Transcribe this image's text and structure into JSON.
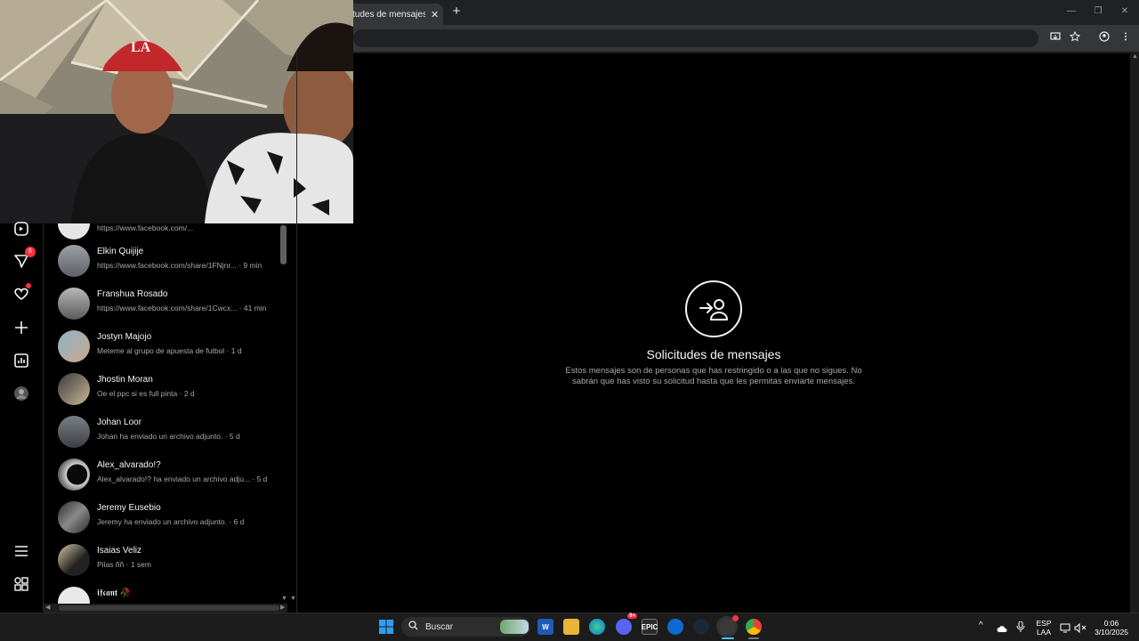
{
  "browser": {
    "tab_title": "tudes de mensajes • D",
    "tab_close": "✕",
    "new_tab": "+",
    "win_min": "—",
    "win_max": "❐",
    "win_close": "✕"
  },
  "nav": {
    "messages_badge": "6"
  },
  "requests": [
    {
      "name": "",
      "preview": "https://www.facebook.com/...",
      "time": ""
    },
    {
      "name": "Elkin Quijije",
      "preview": "https://www.facebook.com/share/1FNjnr...",
      "time": "9 min"
    },
    {
      "name": "Franshua Rosado",
      "preview": "https://www.facebook.com/share/1Cwcx...",
      "time": "41 min"
    },
    {
      "name": "Jostyn Majojo",
      "preview": "Meteme al grupo de apuesta de futbol",
      "time": "1 d"
    },
    {
      "name": "Jhostin Moran",
      "preview": "Oe el ppc si es full pinta",
      "time": "2 d"
    },
    {
      "name": "Johan Loor",
      "preview": "Johan ha enviado un archivo adjunto.",
      "time": "5 d"
    },
    {
      "name": "Alex_alvarado!?",
      "preview": "Alex_alvarado!? ha enviado un archivo adju...",
      "time": "5 d"
    },
    {
      "name": "Jeremy Eusebio",
      "preview": "Jeremy ha enviado un archivo adjunto.",
      "time": "6 d"
    },
    {
      "name": "Isaias Veliz",
      "preview": "Pilas ññ",
      "time": "1 sem"
    },
    {
      "name": "𝖎𝖋𝖈𝖆𝖓𝖙 🥀",
      "preview": "",
      "time": ""
    }
  ],
  "main": {
    "title": "Solicitudes de mensajes",
    "description": "Estos mensajes son de personas que has restringido o a las que no sigues. No sabrán que has visto su solicitud hasta que les permitas enviarte mensajes."
  },
  "taskbar": {
    "search_label": "Buscar",
    "lang_1": "ESP",
    "lang_2": "LAA",
    "time": "0:06",
    "date": "3/10/2025",
    "discord_badge": "9+"
  },
  "colors": {
    "badge": "#ff3040",
    "accent_blue": "#0078d4"
  }
}
